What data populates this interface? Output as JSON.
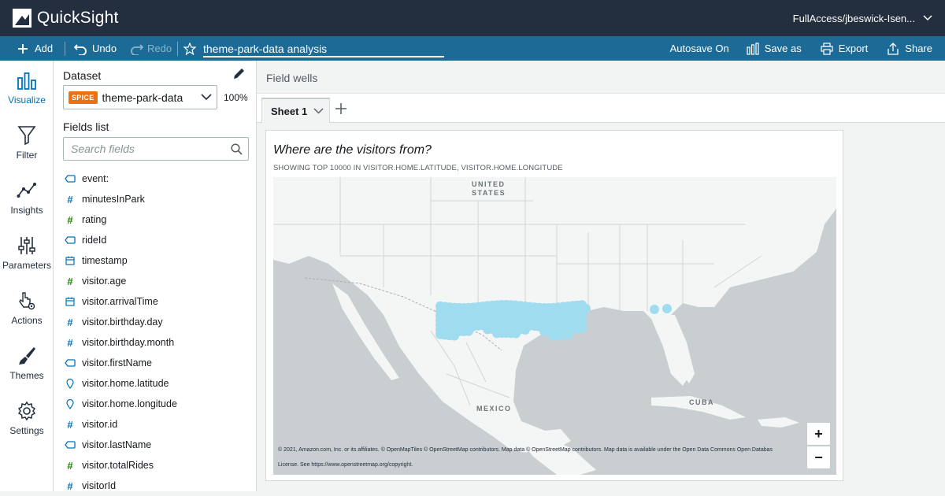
{
  "app": {
    "name": "QuickSight",
    "account": "FullAccess/jbeswick-Isen..."
  },
  "toolbar": {
    "add_label": "Add",
    "undo_label": "Undo",
    "redo_label": "Redo",
    "analysis_name": "theme-park-data analysis",
    "autosave_label": "Autosave On",
    "save_as_label": "Save as",
    "export_label": "Export",
    "share_label": "Share"
  },
  "leftnav": {
    "items": [
      {
        "label": "Visualize",
        "icon": "bar-chart-icon",
        "active": true
      },
      {
        "label": "Filter",
        "icon": "funnel-icon"
      },
      {
        "label": "Insights",
        "icon": "insights-icon"
      },
      {
        "label": "Parameters",
        "icon": "sliders-icon"
      },
      {
        "label": "Actions",
        "icon": "pointer-gear-icon"
      },
      {
        "label": "Themes",
        "icon": "brush-icon"
      },
      {
        "label": "Settings",
        "icon": "gear-icon"
      }
    ]
  },
  "fields_panel": {
    "dataset_title": "Dataset",
    "spice_badge": "SPICE",
    "dataset_name": "theme-park-data",
    "spice_percent": "100%",
    "fields_title": "Fields list",
    "search_placeholder": "Search fields",
    "fields": [
      {
        "name": "event:",
        "type": "string"
      },
      {
        "name": "minutesInPark",
        "type": "number"
      },
      {
        "name": "rating",
        "type": "number-green"
      },
      {
        "name": "rideId",
        "type": "string"
      },
      {
        "name": "timestamp",
        "type": "date"
      },
      {
        "name": "visitor.age",
        "type": "number-green"
      },
      {
        "name": "visitor.arrivalTime",
        "type": "date"
      },
      {
        "name": "visitor.birthday.day",
        "type": "number"
      },
      {
        "name": "visitor.birthday.month",
        "type": "number"
      },
      {
        "name": "visitor.firstName",
        "type": "string"
      },
      {
        "name": "visitor.home.latitude",
        "type": "geo"
      },
      {
        "name": "visitor.home.longitude",
        "type": "geo"
      },
      {
        "name": "visitor.id",
        "type": "number"
      },
      {
        "name": "visitor.lastName",
        "type": "string"
      },
      {
        "name": "visitor.totalRides",
        "type": "number-green"
      },
      {
        "name": "visitorId",
        "type": "number"
      }
    ]
  },
  "main": {
    "field_wells_label": "Field wells",
    "sheet_tab_label": "Sheet 1"
  },
  "visual": {
    "title": "Where are the visitors from?",
    "subtitle": "SHOWING TOP 10000 IN VISITOR.HOME.LATITUDE, VISITOR.HOME.LONGITUDE",
    "map_labels": {
      "us_line1": "UNITED",
      "us_line2": "STATES",
      "mexico": "MEXICO",
      "cuba": "CUBA"
    },
    "attribution_line1": "© 2021, Amazon.com, Inc. or its affiliates. © OpenMapTiles © OpenStreetMap contributors. Map data © OpenStreetMap contributors. Map data is available under the Open Data Commons Open Databas",
    "attribution_line2": "License. See https://www.openstreetmap.org/copyright.",
    "zoom_in": "+",
    "zoom_out": "−",
    "point_color": "#a0dcef"
  },
  "colors": {
    "topbar": "#232f3e",
    "toolbar": "#1c6b96",
    "accent": "#0073bb",
    "spice": "#ec7211",
    "number_field": "#0073bb",
    "measure_field": "#1d8102"
  }
}
